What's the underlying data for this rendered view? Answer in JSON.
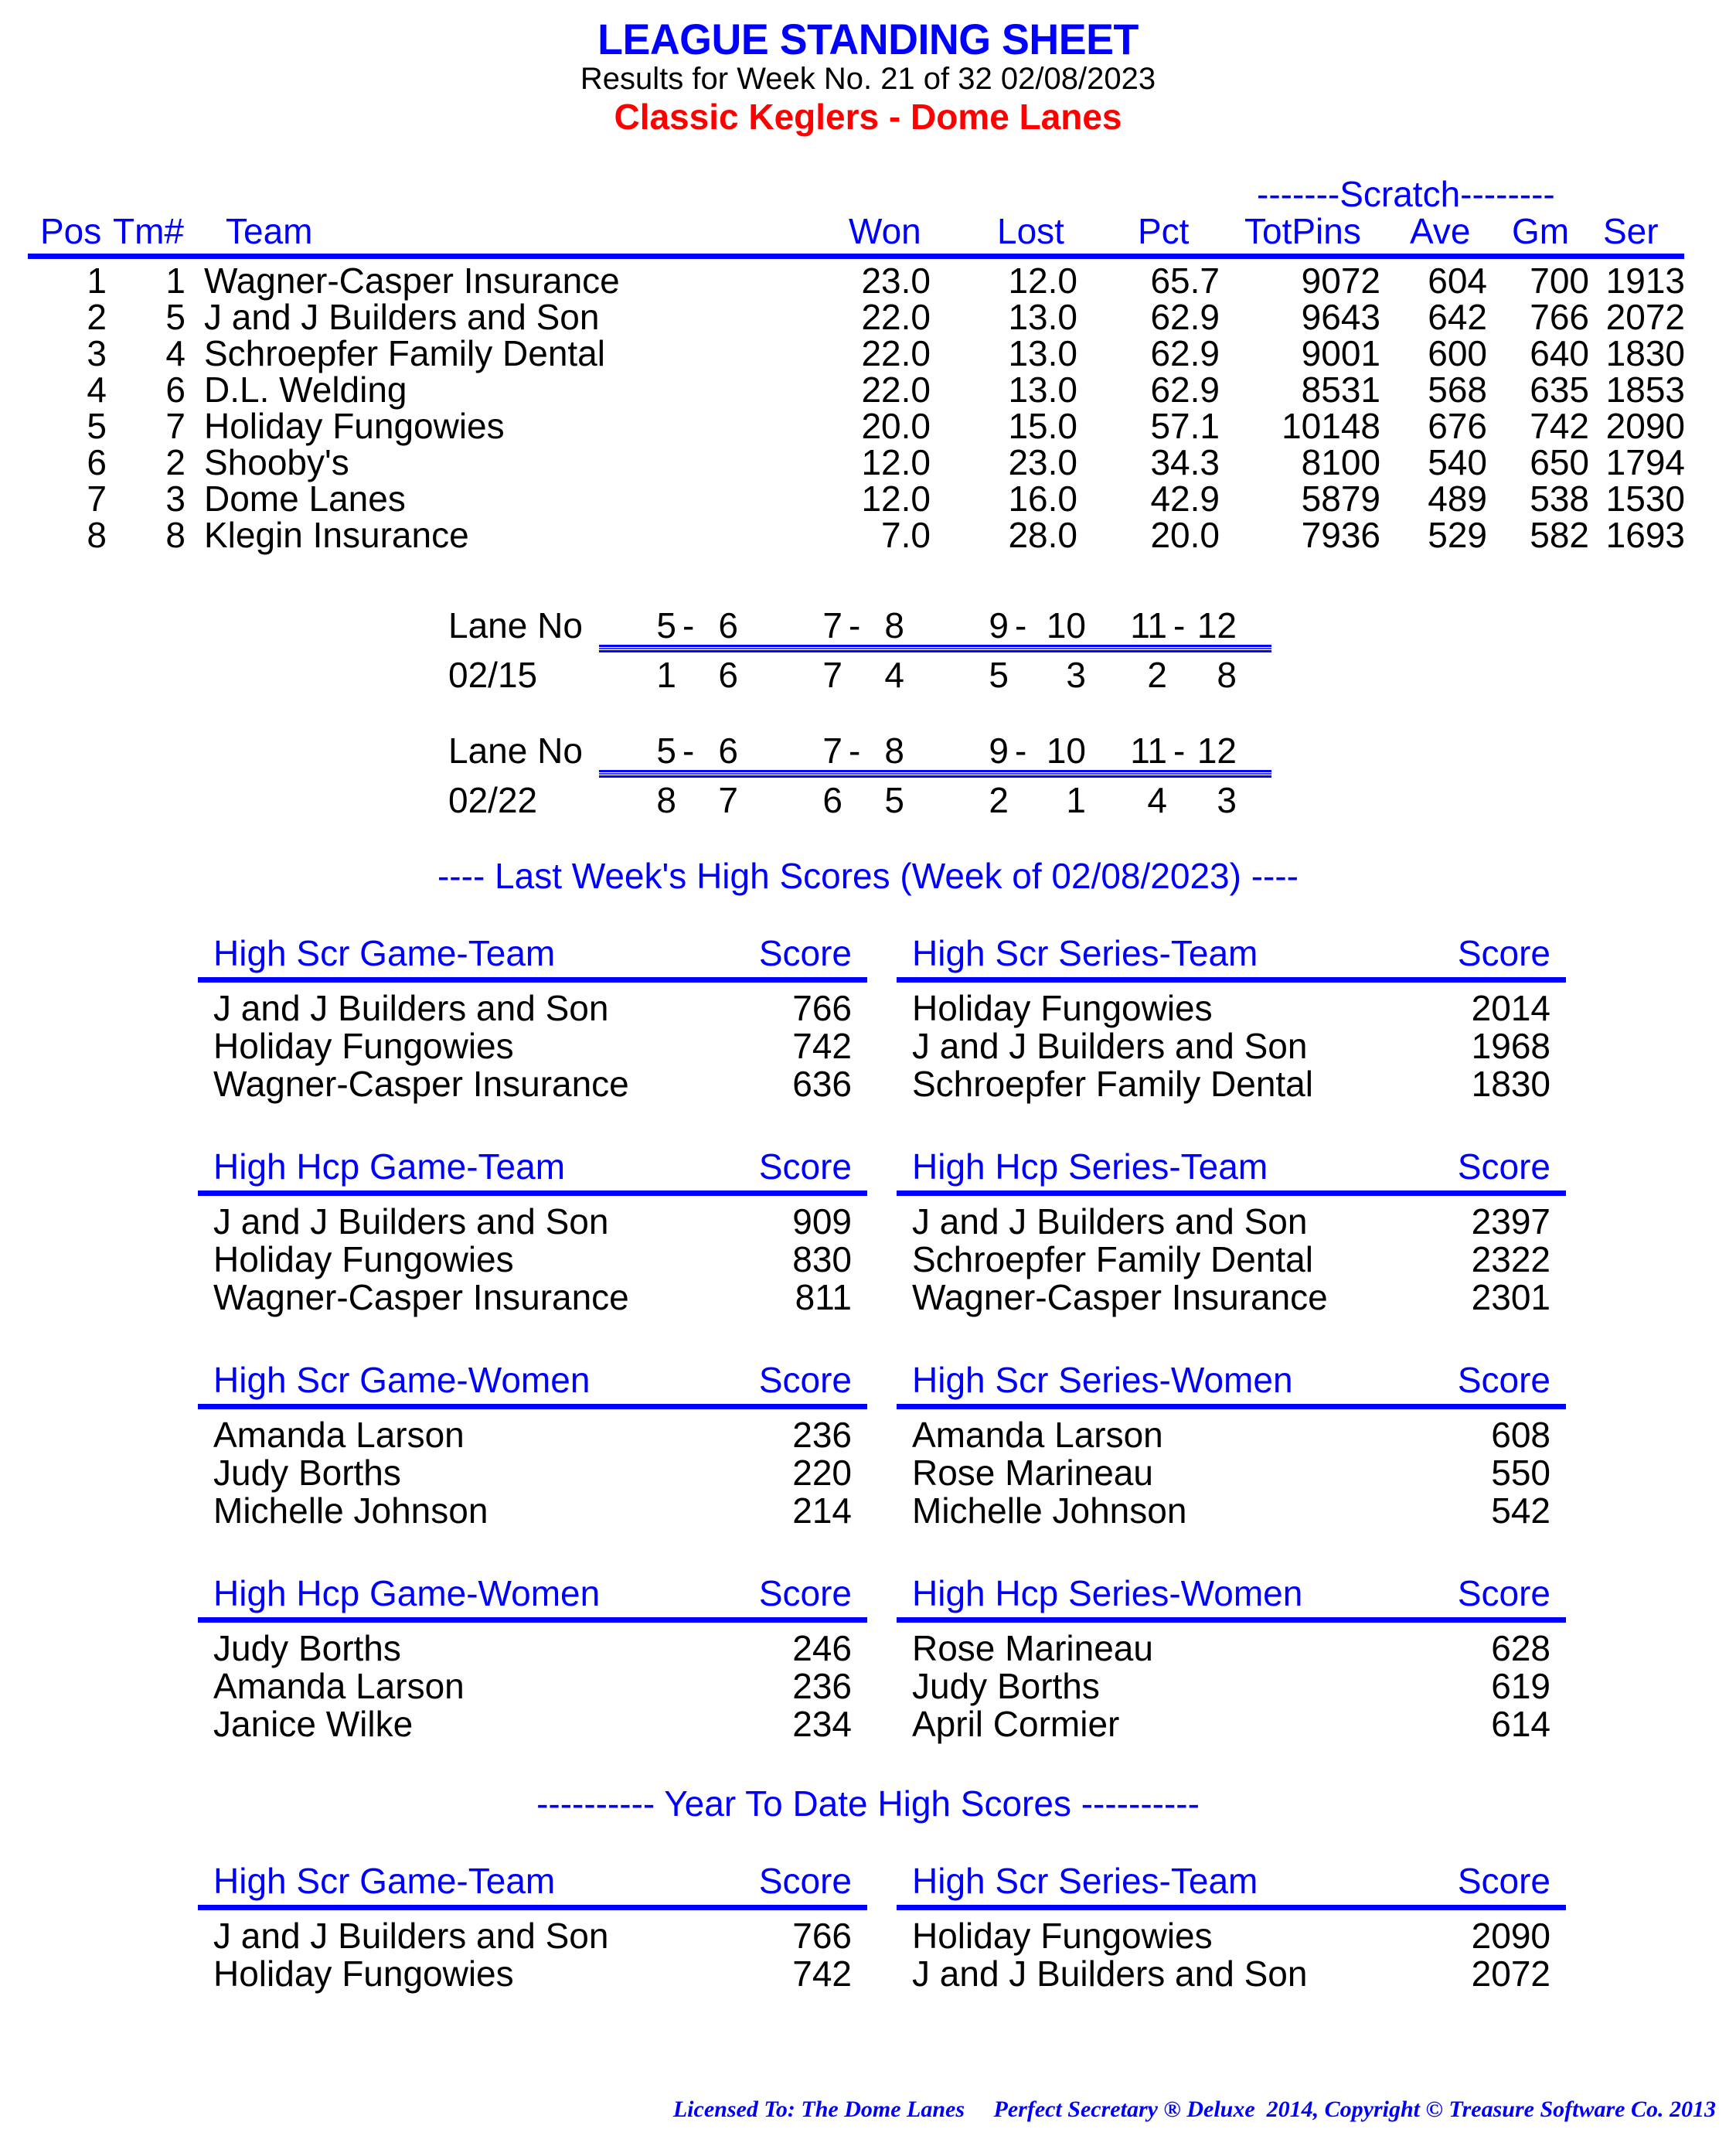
{
  "header": {
    "title": "LEAGUE STANDING SHEET",
    "subtitle": "Results for Week No. 21 of 32    02/08/2023",
    "league_name": "Classic Keglers - Dome Lanes"
  },
  "colors": {
    "heading": "#0000ff",
    "league_name": "#ff0000",
    "body_text": "#000000"
  },
  "standings": {
    "scratch_label": "-------Scratch--------",
    "columns": [
      "Pos",
      "Tm#",
      "Team",
      "Won",
      "Lost",
      "Pct",
      "TotPins",
      "Ave",
      "Gm",
      "Ser"
    ],
    "rows": [
      {
        "pos": "1",
        "tm": "1",
        "team": "Wagner-Casper Insurance",
        "won": "23.0",
        "lost": "12.0",
        "pct": "65.7",
        "totpins": "9072",
        "ave": "604",
        "gm": "700",
        "ser": "1913"
      },
      {
        "pos": "2",
        "tm": "5",
        "team": "J and J Builders and Son",
        "won": "22.0",
        "lost": "13.0",
        "pct": "62.9",
        "totpins": "9643",
        "ave": "642",
        "gm": "766",
        "ser": "2072"
      },
      {
        "pos": "3",
        "tm": "4",
        "team": "Schroepfer Family Dental",
        "won": "22.0",
        "lost": "13.0",
        "pct": "62.9",
        "totpins": "9001",
        "ave": "600",
        "gm": "640",
        "ser": "1830"
      },
      {
        "pos": "4",
        "tm": "6",
        "team": "D.L. Welding",
        "won": "22.0",
        "lost": "13.0",
        "pct": "62.9",
        "totpins": "8531",
        "ave": "568",
        "gm": "635",
        "ser": "1853"
      },
      {
        "pos": "5",
        "tm": "7",
        "team": "Holiday Fungowies",
        "won": "20.0",
        "lost": "15.0",
        "pct": "57.1",
        "totpins": "10148",
        "ave": "676",
        "gm": "742",
        "ser": "2090"
      },
      {
        "pos": "6",
        "tm": "2",
        "team": "Shooby's",
        "won": "12.0",
        "lost": "23.0",
        "pct": "34.3",
        "totpins": "8100",
        "ave": "540",
        "gm": "650",
        "ser": "1794"
      },
      {
        "pos": "7",
        "tm": "3",
        "team": "Dome Lanes",
        "won": "12.0",
        "lost": "16.0",
        "pct": "42.9",
        "totpins": "5879",
        "ave": "489",
        "gm": "538",
        "ser": "1530"
      },
      {
        "pos": "8",
        "tm": "8",
        "team": "Klegin Insurance",
        "won": "7.0",
        "lost": "28.0",
        "pct": "20.0",
        "totpins": "7936",
        "ave": "529",
        "gm": "582",
        "ser": "1693"
      }
    ]
  },
  "lane_schedule": [
    {
      "label": "Lane No",
      "lanes": [
        [
          "5",
          "6"
        ],
        [
          "7",
          "8"
        ],
        [
          "9",
          "10"
        ],
        [
          "11",
          "12"
        ]
      ],
      "date": "02/15",
      "matchups": [
        [
          "1",
          "6"
        ],
        [
          "7",
          "4"
        ],
        [
          "5",
          "3"
        ],
        [
          "2",
          "8"
        ]
      ]
    },
    {
      "label": "Lane No",
      "lanes": [
        [
          "5",
          "6"
        ],
        [
          "7",
          "8"
        ],
        [
          "9",
          "10"
        ],
        [
          "11",
          "12"
        ]
      ],
      "date": "02/22",
      "matchups": [
        [
          "8",
          "7"
        ],
        [
          "6",
          "5"
        ],
        [
          "2",
          "1"
        ],
        [
          "4",
          "3"
        ]
      ]
    }
  ],
  "last_week": {
    "banner": "----  Last Week's High Scores   (Week of 02/08/2023)  ----",
    "sections": [
      {
        "title": "High Scr Game-Team",
        "score_label": "Score",
        "rows": [
          {
            "name": "J and J Builders and Son",
            "score": "766"
          },
          {
            "name": "Holiday Fungowies",
            "score": "742"
          },
          {
            "name": "Wagner-Casper Insurance",
            "score": "636"
          }
        ]
      },
      {
        "title": "High Scr Series-Team",
        "score_label": "Score",
        "rows": [
          {
            "name": "Holiday Fungowies",
            "score": "2014"
          },
          {
            "name": "J and J Builders and Son",
            "score": "1968"
          },
          {
            "name": "Schroepfer Family Dental",
            "score": "1830"
          }
        ]
      },
      {
        "title": "High Hcp Game-Team",
        "score_label": "Score",
        "rows": [
          {
            "name": "J and J Builders and Son",
            "score": "909"
          },
          {
            "name": "Holiday Fungowies",
            "score": "830"
          },
          {
            "name": "Wagner-Casper Insurance",
            "score": "811"
          }
        ]
      },
      {
        "title": "High Hcp Series-Team",
        "score_label": "Score",
        "rows": [
          {
            "name": "J and J Builders and Son",
            "score": "2397"
          },
          {
            "name": "Schroepfer Family Dental",
            "score": "2322"
          },
          {
            "name": "Wagner-Casper Insurance",
            "score": "2301"
          }
        ]
      },
      {
        "title": "High Scr Game-Women",
        "score_label": "Score",
        "rows": [
          {
            "name": "Amanda Larson",
            "score": "236"
          },
          {
            "name": "Judy Borths",
            "score": "220"
          },
          {
            "name": "Michelle Johnson",
            "score": "214"
          }
        ]
      },
      {
        "title": "High Scr Series-Women",
        "score_label": "Score",
        "rows": [
          {
            "name": "Amanda Larson",
            "score": "608"
          },
          {
            "name": "Rose Marineau",
            "score": "550"
          },
          {
            "name": "Michelle Johnson",
            "score": "542"
          }
        ]
      },
      {
        "title": "High Hcp Game-Women",
        "score_label": "Score",
        "rows": [
          {
            "name": "Judy Borths",
            "score": "246"
          },
          {
            "name": "Amanda Larson",
            "score": "236"
          },
          {
            "name": "Janice Wilke",
            "score": "234"
          }
        ]
      },
      {
        "title": "High Hcp Series-Women",
        "score_label": "Score",
        "rows": [
          {
            "name": "Rose Marineau",
            "score": "628"
          },
          {
            "name": "Judy Borths",
            "score": "619"
          },
          {
            "name": "April Cormier",
            "score": "614"
          }
        ]
      }
    ]
  },
  "year_to_date": {
    "banner": "---------- Year To Date High Scores ----------",
    "sections": [
      {
        "title": "High Scr Game-Team",
        "score_label": "Score",
        "rows": [
          {
            "name": "J and J Builders and Son",
            "score": "766"
          },
          {
            "name": "Holiday Fungowies",
            "score": "742"
          }
        ]
      },
      {
        "title": "High Scr Series-Team",
        "score_label": "Score",
        "rows": [
          {
            "name": "Holiday Fungowies",
            "score": "2090"
          },
          {
            "name": "J and J Builders and Son",
            "score": "2072"
          }
        ]
      }
    ]
  },
  "footer": {
    "text": "Licensed To: The Dome Lanes     Perfect Secretary ® Deluxe  2014, Copyright © Treasure Software Co. 2013"
  }
}
